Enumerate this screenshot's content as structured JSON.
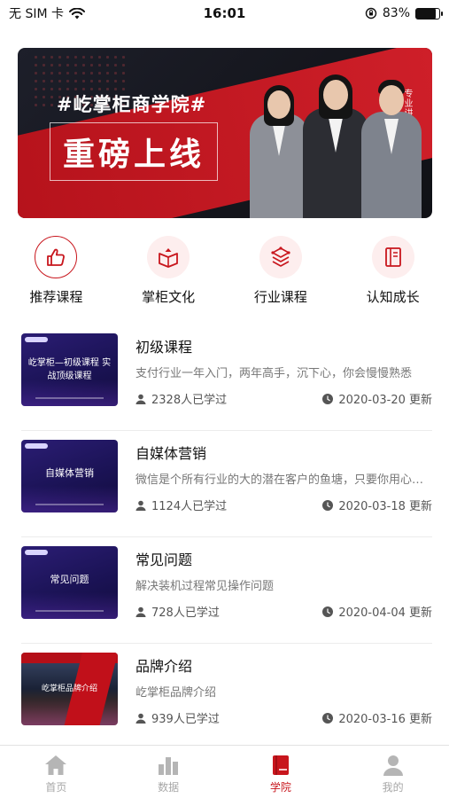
{
  "status_bar": {
    "carrier": "无 SIM 卡",
    "time": "16:01",
    "battery_percent": "83%",
    "battery_level": 0.83
  },
  "banner": {
    "title": "#屹掌柜商学院#",
    "headline": "重磅上线",
    "side_text": "专业讲师团队"
  },
  "categories": [
    {
      "label": "推荐课程",
      "icon": "thumbs-up-icon"
    },
    {
      "label": "掌柜文化",
      "icon": "open-book-icon"
    },
    {
      "label": "行业课程",
      "icon": "layers-icon"
    },
    {
      "label": "认知成长",
      "icon": "book-icon"
    }
  ],
  "courses": [
    {
      "title": "初级课程",
      "desc": "支付行业一年入门，两年高手，沉下心，你会慢慢熟悉",
      "learners": "2328人已学过",
      "updated": "2020-03-20 更新",
      "thumb_text": "屹掌柜—初级课程 实战顶级课程"
    },
    {
      "title": "自媒体营销",
      "desc": "微信是个所有行业的大的潜在客户的鱼塘，只要你用心经营",
      "learners": "1124人已学过",
      "updated": "2020-03-18 更新",
      "thumb_text": "自媒体营销"
    },
    {
      "title": "常见问题",
      "desc": "解决装机过程常见操作问题",
      "learners": "728人已学过",
      "updated": "2020-04-04 更新",
      "thumb_text": "常见问题"
    },
    {
      "title": "品牌介绍",
      "desc": "屹掌柜品牌介绍",
      "learners": "939人已学过",
      "updated": "2020-03-16 更新",
      "thumb_text": "屹掌柜品牌介绍"
    }
  ],
  "tab_bar": [
    {
      "label": "首页",
      "icon": "home-icon"
    },
    {
      "label": "数据",
      "icon": "bar-chart-icon"
    },
    {
      "label": "学院",
      "icon": "book-icon",
      "active": true
    },
    {
      "label": "我的",
      "icon": "person-icon"
    }
  ],
  "colors": {
    "accent": "#c8161d",
    "inactive_tab": "#a7a7a7"
  }
}
